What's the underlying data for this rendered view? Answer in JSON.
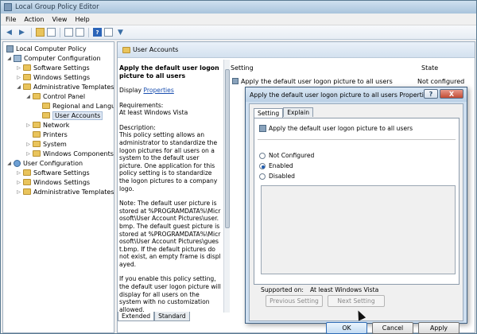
{
  "window": {
    "title": "Local Group Policy Editor"
  },
  "menu": [
    "File",
    "Action",
    "View",
    "Help"
  ],
  "tree": {
    "items": [
      {
        "label": "Local Computer Policy",
        "level": 0
      },
      {
        "label": "Computer Configuration",
        "level": 1
      },
      {
        "label": "Software Settings",
        "level": 2
      },
      {
        "label": "Windows Settings",
        "level": 2
      },
      {
        "label": "Administrative Templates",
        "level": 2
      },
      {
        "label": "Control Panel",
        "level": 3
      },
      {
        "label": "Regional and Langu",
        "level": 4
      },
      {
        "label": "User Accounts",
        "level": 4
      },
      {
        "label": "Network",
        "level": 3
      },
      {
        "label": "Printers",
        "level": 3
      },
      {
        "label": "System",
        "level": 3
      },
      {
        "label": "Windows Components",
        "level": 3
      },
      {
        "label": "User Configuration",
        "level": 1
      },
      {
        "label": "Software Settings",
        "level": 2
      },
      {
        "label": "Windows Settings",
        "level": 2
      },
      {
        "label": "Administrative Templates",
        "level": 2
      }
    ]
  },
  "right": {
    "header": "User Accounts",
    "desc_title": "Apply the default user logon picture to all users",
    "display_label": "Display",
    "properties_link": "Properties",
    "requirements_label": "Requirements:",
    "requirements_value": "At least Windows Vista",
    "description_label": "Description:",
    "description_p1": "This policy setting allows an administrator to standardize the logon pictures for all users on a system to the default user picture. One application for this policy setting is to standardize the logon pictures to a company logo.",
    "description_p2": "Note: The default user picture is stored at %PROGRAMDATA%\\Microsoft\\User Account Pictures\\user.bmp. The default guest picture is stored at %PROGRAMDATA%\\Microsoft\\User Account Pictures\\guest.bmp. If the default pictures do not exist, an empty frame is displayed.",
    "description_p3": "If you enable this policy setting, the default user logon picture will display for all users on the system with no customization allowed.",
    "tabs": [
      "Extended",
      "Standard"
    ],
    "col_setting": "Setting",
    "col_state": "State",
    "row_setting": "Apply the default user logon picture to all users",
    "row_state": "Not configured"
  },
  "dialog": {
    "title": "Apply the default user logon picture to all users Properties",
    "help": "?",
    "close": "X",
    "tabs": [
      "Setting",
      "Explain"
    ],
    "policy_name": "Apply the default user logon picture to all users",
    "options": [
      "Not Configured",
      "Enabled",
      "Disabled"
    ],
    "selected": "Enabled",
    "supported_label": "Supported on:",
    "supported_value": "At least Windows Vista",
    "prev_button": "Previous Setting",
    "next_button": "Next Setting",
    "ok": "OK",
    "cancel": "Cancel",
    "apply": "Apply"
  }
}
